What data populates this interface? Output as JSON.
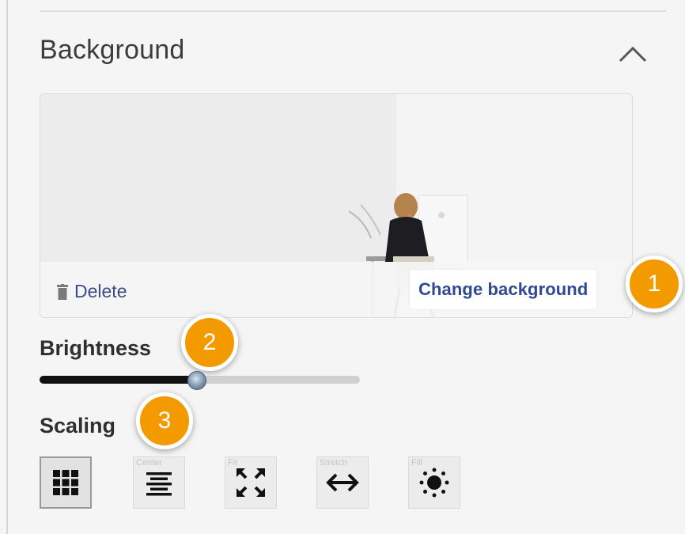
{
  "panel": {
    "title": "Background",
    "collapse_icon": "chevron-up-icon"
  },
  "preview": {
    "delete_label": "Delete",
    "delete_icon": "trash-icon",
    "change_label": "Change background"
  },
  "brightness": {
    "label": "Brightness",
    "value_fraction": 0.49
  },
  "scaling": {
    "label": "Scaling",
    "options": [
      {
        "name": "tile",
        "ghost": "",
        "icon": "grid-icon",
        "active": true
      },
      {
        "name": "center",
        "ghost": "Center",
        "icon": "align-center-icon",
        "active": false
      },
      {
        "name": "fit",
        "ghost": "Fit",
        "icon": "expand-arrows-icon",
        "active": false
      },
      {
        "name": "stretch",
        "ghost": "Stretch",
        "icon": "horizontal-arrows-icon",
        "active": false
      },
      {
        "name": "fill",
        "ghost": "Fill",
        "icon": "sun-icon",
        "active": false
      }
    ]
  },
  "callouts": [
    "1",
    "2",
    "3"
  ],
  "colors": {
    "accent": "#f29a00",
    "link": "#2f4a93",
    "slider_fill": "#111111"
  }
}
